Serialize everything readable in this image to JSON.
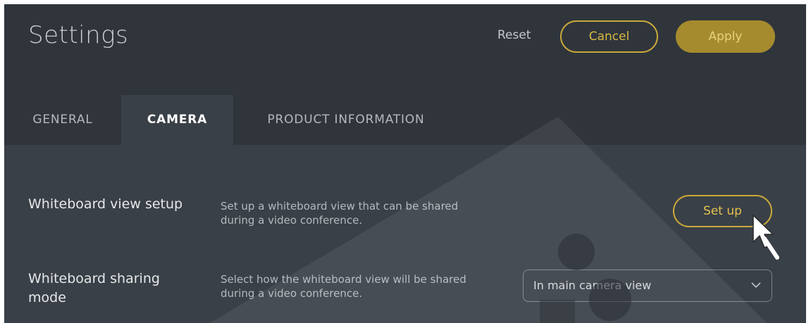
{
  "header": {
    "title": "Settings",
    "reset_label": "Reset",
    "cancel_label": "Cancel",
    "apply_label": "Apply"
  },
  "tabs": [
    {
      "label": "GENERAL",
      "active": false
    },
    {
      "label": "CAMERA",
      "active": true
    },
    {
      "label": "PRODUCT INFORMATION",
      "active": false
    }
  ],
  "settings": {
    "whiteboard_setup": {
      "label": "Whiteboard view setup",
      "description": "Set up a whiteboard view that can be shared during a video conference.",
      "button_label": "Set up"
    },
    "whiteboard_sharing": {
      "label": "Whiteboard sharing mode",
      "description": "Select how the whiteboard view will be shared during a video conference.",
      "selected_value": "In main camera view"
    }
  },
  "icons": {
    "dropdown": "chevron-down-icon",
    "cursor": "mouse-pointer-icon"
  },
  "colors": {
    "accent": "#c9a93a",
    "apply_fill": "#a68b2e",
    "header_bg": "#2f353b",
    "content_bg": "#3a4047"
  }
}
